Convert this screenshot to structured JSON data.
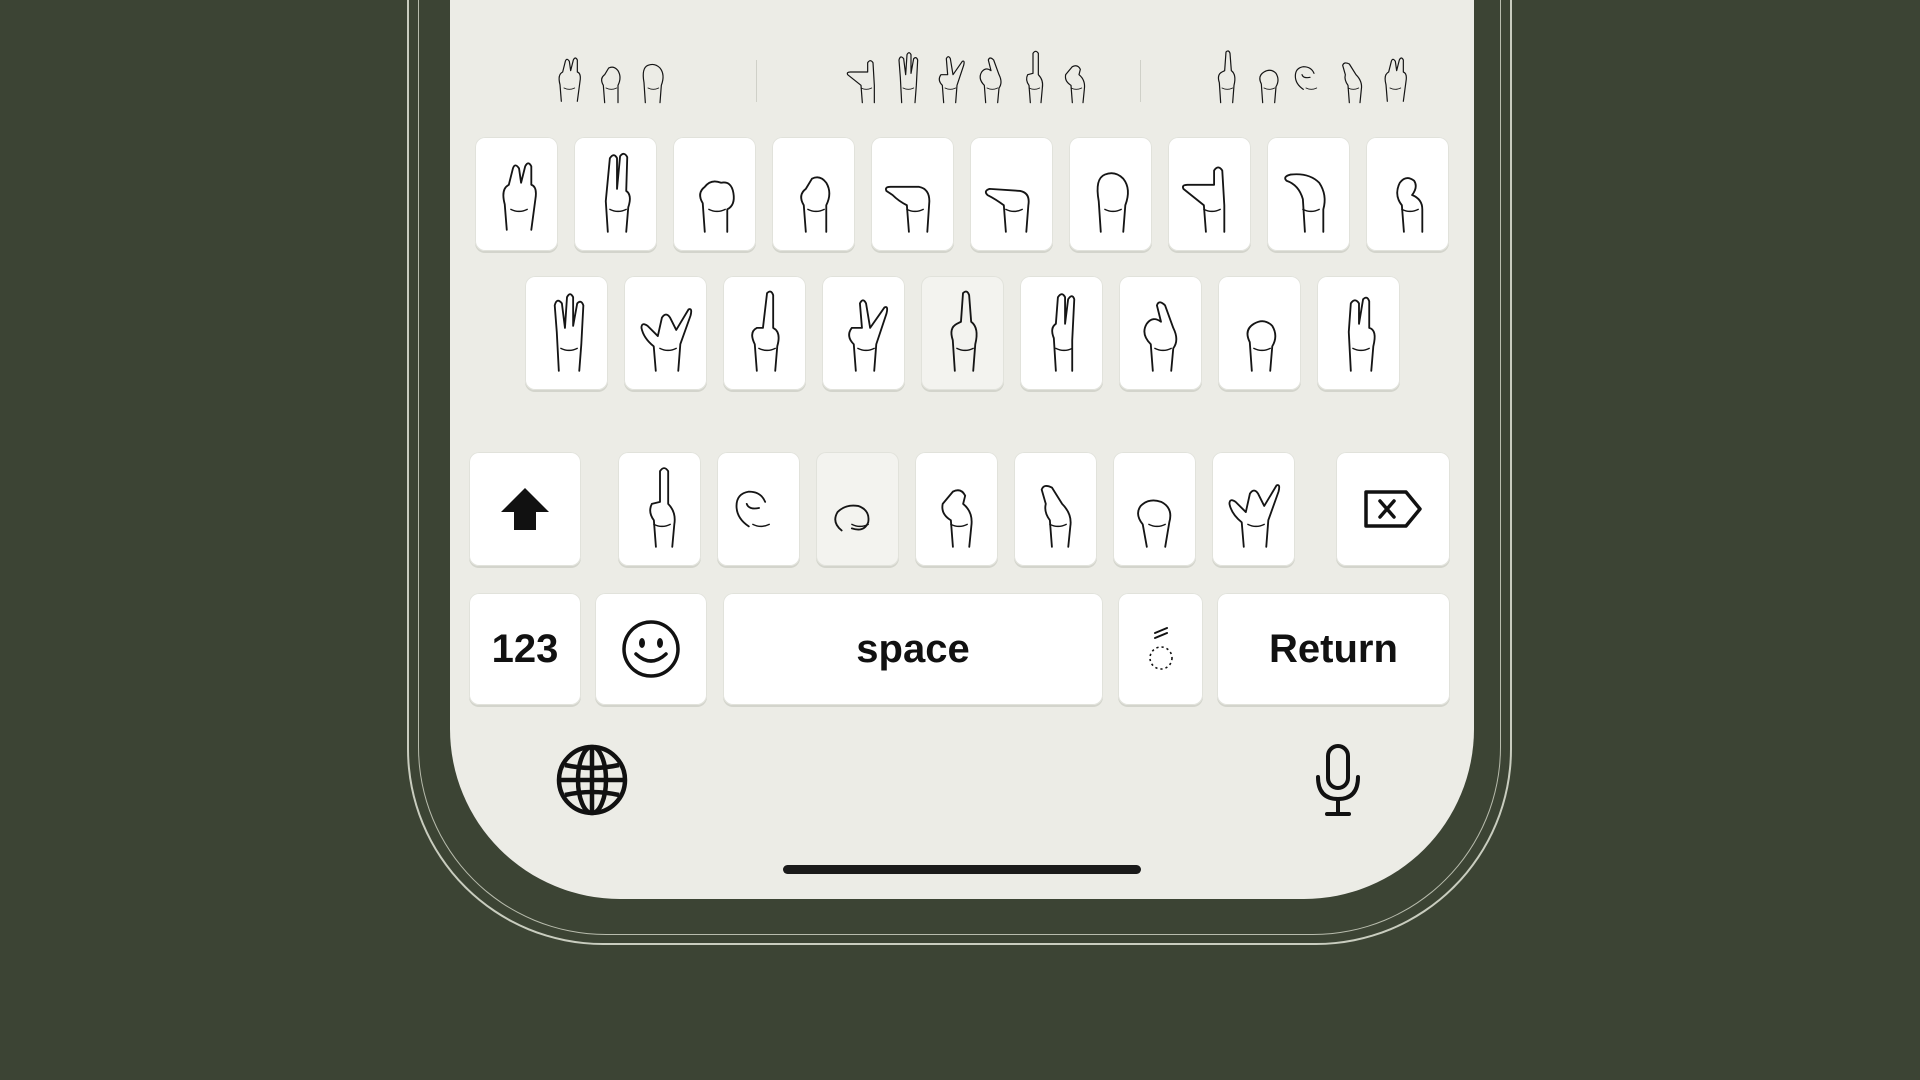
{
  "keyboard": {
    "suggestions": [
      {
        "id": "suggestion-1",
        "glyphs": 3
      },
      {
        "id": "suggestion-2",
        "glyphs": 6
      },
      {
        "id": "suggestion-3",
        "glyphs": 5
      }
    ],
    "row1_keys": 10,
    "row2_keys": 9,
    "row3_keys": 7,
    "labels": {
      "numbers": "123",
      "space": "space",
      "return": "Return"
    },
    "icons": {
      "shift": "shift-arrow-icon",
      "delete": "backspace-icon",
      "emoji": "smiley-icon",
      "globe": "globe-icon",
      "mic": "microphone-icon",
      "accent": "dotted-circle-accent-icon"
    }
  },
  "colors": {
    "background": "#3c4434",
    "screen": "#ecece6",
    "key": "#ffffff",
    "ink": "#111111"
  }
}
